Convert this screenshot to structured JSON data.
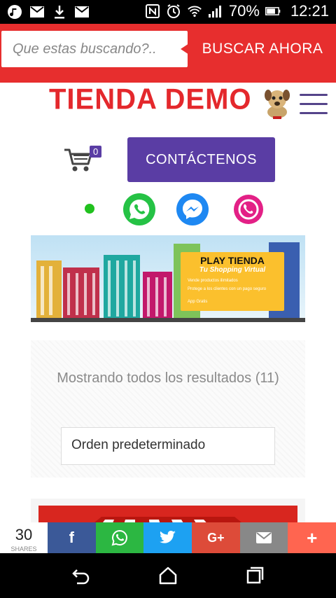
{
  "status_bar": {
    "battery_percent": "70%",
    "time": "12:21",
    "left_icons": [
      "music-icon",
      "gmail-icon",
      "download-icon",
      "gmail-icon"
    ],
    "right_icons": [
      "nfc-icon",
      "alarm-icon",
      "wifi-icon",
      "signal-icon",
      "battery-icon"
    ]
  },
  "search": {
    "placeholder": "Que estas buscando?..",
    "button_label": "BUSCAR AHORA"
  },
  "header": {
    "logo_text": "TIENDA DEMO"
  },
  "cart": {
    "count": "0"
  },
  "contact": {
    "button_label": "CONTÁCTENOS"
  },
  "social": [
    "whatsapp-icon",
    "messenger-icon",
    "viber-icon"
  ],
  "banner": {
    "title": "PLAY TIENDA",
    "subtitle": "Tu Shopping Virtual",
    "bullets": [
      "Vende productos ilimitados",
      "Protege a los clientes con un pago seguro",
      "App Gratis"
    ]
  },
  "results": {
    "text": "Mostrando todos los resultados (11)",
    "sort_selected": "Orden predeterminado"
  },
  "share": {
    "count": "30",
    "count_label": "SHARES",
    "buttons": [
      {
        "name": "facebook",
        "label": "f",
        "color": "#3b5998"
      },
      {
        "name": "whatsapp",
        "label": "✆",
        "color": "#2cb742"
      },
      {
        "name": "twitter",
        "label": "🐦",
        "color": "#1da1f2"
      },
      {
        "name": "googleplus",
        "label": "G+",
        "color": "#dd4b39"
      },
      {
        "name": "email",
        "label": "✉",
        "color": "#888888"
      },
      {
        "name": "more",
        "label": "+",
        "color": "#ff6550"
      }
    ]
  },
  "colors": {
    "brand_red": "#e72e2e",
    "brand_purple": "#5a3da4"
  }
}
